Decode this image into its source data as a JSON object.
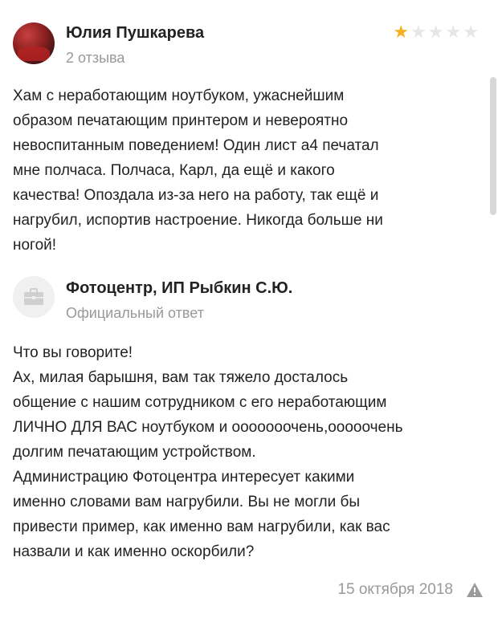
{
  "review": {
    "author": "Юлия Пушкарева",
    "review_count": "2 отзыва",
    "rating": 1,
    "rating_max": 5,
    "text": "Хам с неработающим ноутбуком, ужаснейшим\nобразом печатающим принтером и невероятно\nневоспитанным поведением! Один лист а4 печатал\nмне полчаса. Полчаса, Карл, да ещё и какого\nкачества! Опоздала из-за него на работу, так ещё и\nнагрубил, испортив настроение. Никогда больше ни\nногой!"
  },
  "reply": {
    "author": "Фотоцентр, ИП Рыбкин С.Ю.",
    "label": "Официальный ответ",
    "text": "Что вы говорите!\nАх, милая барышня, вам так тяжело досталось\nобщение с нашим сотрудником с его неработающим\nЛИЧНО ДЛЯ ВАС ноутбуком и ооооооочень,ооооочень\nдолгим печатающим устройством.\nАдминистрацию Фотоцентра интересует какими\nименно словами вам нагрубили. Вы не могли бы\nпривести пример, как именно вам нагрубили, как вас\nназвали и как именно оскорбили?",
    "date": "15 октября 2018"
  },
  "colors": {
    "star_on": "#f6b01e",
    "star_off": "#e6e6e6",
    "muted_text": "#999999"
  },
  "icons": {
    "reply_avatar": "briefcase-icon",
    "report": "warning-icon"
  }
}
